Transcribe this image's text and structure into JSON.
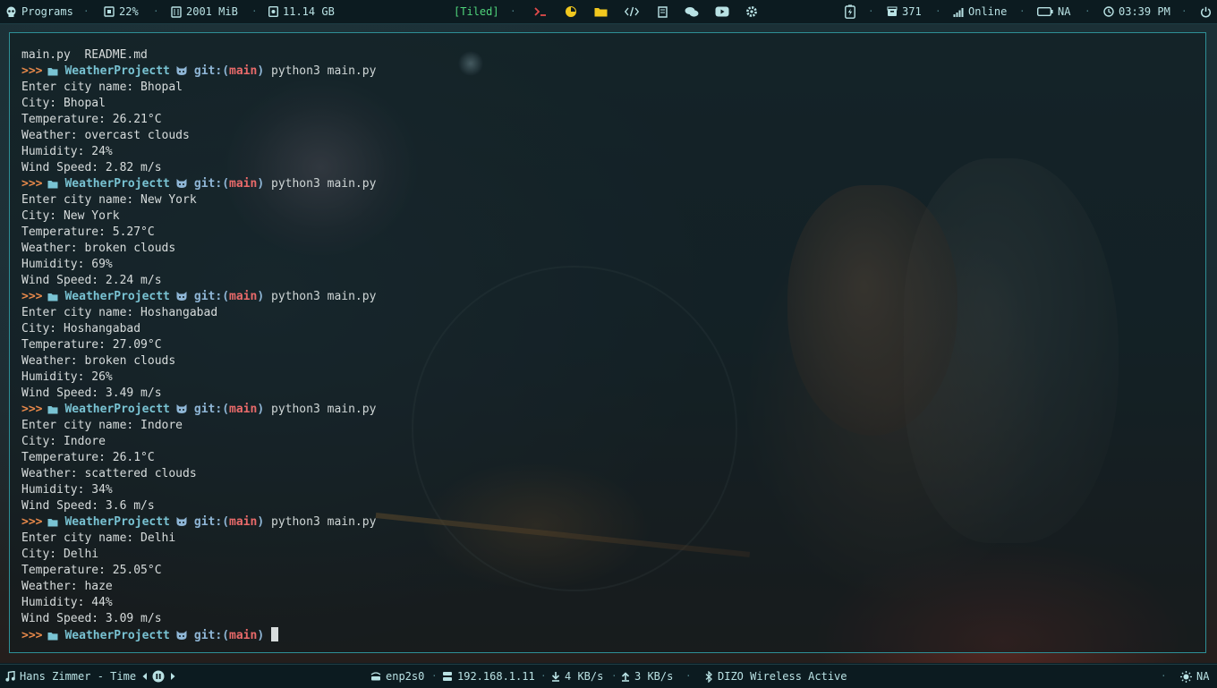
{
  "topbar": {
    "left": {
      "programs": "Programs",
      "cpu": "22%",
      "ram": "2001 MiB",
      "disk": "11.14 GB"
    },
    "layout": "[Tiled]",
    "right": {
      "updates": "371",
      "network": "Online",
      "battery": "NA",
      "clock": "03:39 PM"
    }
  },
  "terminal": {
    "ls_output": "main.py  README.md",
    "prompt": {
      "arrow": ">>>",
      "dir": "WeatherProjectt",
      "git_prefix": "git:(",
      "branch": "main",
      "git_suffix": ")"
    },
    "runs": [
      {
        "command": "python3 main.py",
        "output": [
          "Enter city name: Bhopal",
          "City: Bhopal",
          "Temperature: 26.21°C",
          "Weather: overcast clouds",
          "Humidity: 24%",
          "Wind Speed: 2.82 m/s"
        ]
      },
      {
        "command": "python3 main.py",
        "output": [
          "Enter city name: New York",
          "City: New York",
          "Temperature: 5.27°C",
          "Weather: broken clouds",
          "Humidity: 69%",
          "Wind Speed: 2.24 m/s"
        ]
      },
      {
        "command": "python3 main.py",
        "output": [
          "Enter city name: Hoshangabad",
          "City: Hoshangabad",
          "Temperature: 27.09°C",
          "Weather: broken clouds",
          "Humidity: 26%",
          "Wind Speed: 3.49 m/s"
        ]
      },
      {
        "command": "python3 main.py",
        "output": [
          "Enter city name: Indore",
          "City: Indore",
          "Temperature: 26.1°C",
          "Weather: scattered clouds",
          "Humidity: 34%",
          "Wind Speed: 3.6 m/s"
        ]
      },
      {
        "command": "python3 main.py",
        "output": [
          "Enter city name: Delhi",
          "City: Delhi",
          "Temperature: 25.05°C",
          "Weather: haze",
          "Humidity: 44%",
          "Wind Speed: 3.09 m/s"
        ]
      }
    ]
  },
  "bottombar": {
    "music": "Hans Zimmer - Time",
    "interface": "enp2s0",
    "ip": "192.168.1.11",
    "download": "4 KB/s",
    "upload": "3 KB/s",
    "bluetooth": "DIZO Wireless Active",
    "brightness": "NA"
  },
  "colors": {
    "bar_bg": "#0c1b20",
    "text": "#b9e2e4",
    "terminal_border": "#2e8f96",
    "prompt_arrow": "#e8894a",
    "prompt_dir": "#79c3d3",
    "prompt_branch": "#e96a6a",
    "layout_tag": "#4fd37a"
  }
}
